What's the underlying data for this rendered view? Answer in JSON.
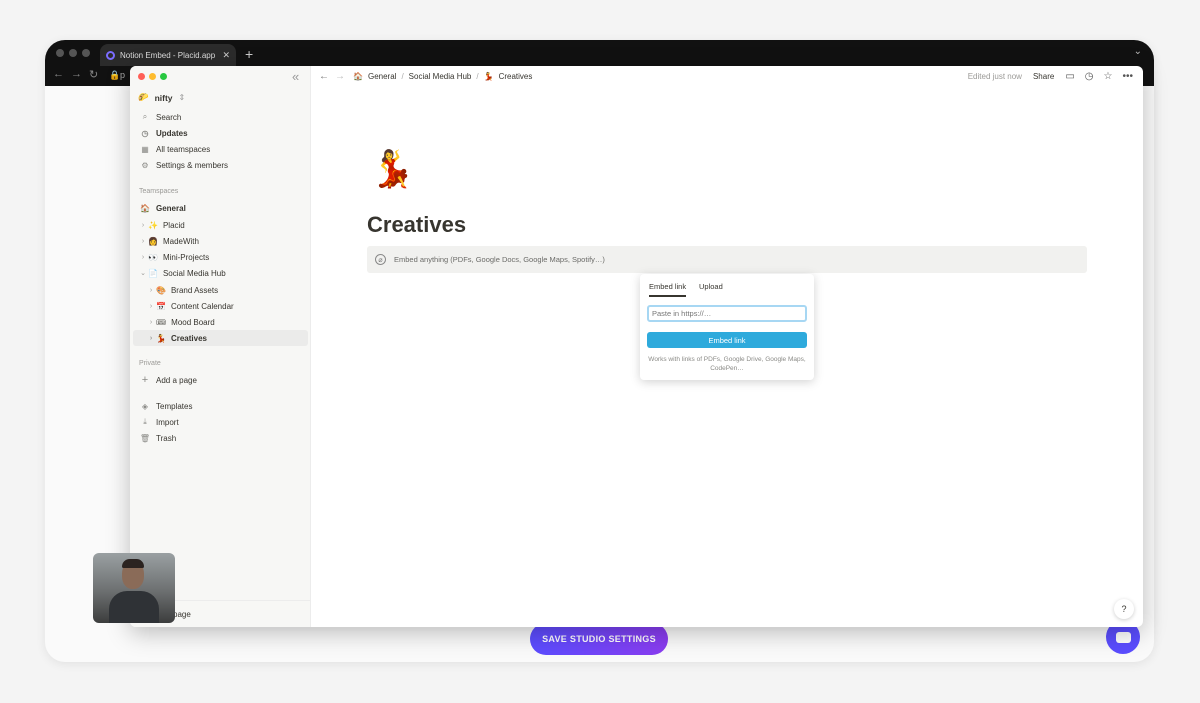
{
  "browser": {
    "tab_title": "Notion Embed - Placid.app",
    "tab_close": "✕",
    "new_tab": "+",
    "url_fragment": "p",
    "save_button": "SAVE STUDIO SETTINGS"
  },
  "sidebar": {
    "workspace": "nifty",
    "workspace_emoji": "🌮",
    "nav": [
      {
        "label": "Search",
        "icon": "⌕"
      },
      {
        "label": "Updates",
        "icon": "◷"
      },
      {
        "label": "All teamspaces",
        "icon": "▦"
      },
      {
        "label": "Settings & members",
        "icon": "⚙"
      }
    ],
    "teamspaces_label": "Teamspaces",
    "teamspaces": [
      {
        "label": "General",
        "emoji": "🏠"
      },
      {
        "label": "Placid",
        "emoji": "✨"
      },
      {
        "label": "MadeWith",
        "emoji": "👩"
      },
      {
        "label": "Mini-Projects",
        "emoji": "👀"
      },
      {
        "label": "Social Media Hub",
        "emoji": "📄"
      },
      {
        "label": "Brand Assets",
        "emoji": "🎨"
      },
      {
        "label": "Content Calendar",
        "emoji": "📅"
      },
      {
        "label": "Mood Board",
        "emoji": "🎟"
      },
      {
        "label": "Creatives",
        "emoji": "💃"
      }
    ],
    "private_label": "Private",
    "add_page": "Add a page",
    "tools": [
      {
        "label": "Templates",
        "icon": "◈"
      },
      {
        "label": "Import",
        "icon": "⤓"
      },
      {
        "label": "Trash",
        "icon": "🗑"
      }
    ],
    "footer_fragment": "page"
  },
  "topbar": {
    "breadcrumb": [
      {
        "label": "General",
        "emoji": "🏠"
      },
      {
        "label": "Social Media Hub",
        "emoji": ""
      },
      {
        "label": "Creatives",
        "emoji": "💃"
      }
    ],
    "separator": "/",
    "edited": "Edited just now",
    "share": "Share"
  },
  "page": {
    "emoji": "💃",
    "title": "Creatives",
    "embed_placeholder": "Embed anything (PDFs, Google Docs, Google Maps, Spotify…)"
  },
  "popup": {
    "tab_embed": "Embed link",
    "tab_upload": "Upload",
    "input_placeholder": "Paste in https://…",
    "button": "Embed link",
    "note": "Works with links of PDFs, Google Drive, Google Maps, CodePen…"
  },
  "help": "?",
  "colors": {
    "accent_blue": "#2eaadc",
    "save_gradient_start": "#5b4dff",
    "save_gradient_end": "#8b3cf0"
  }
}
